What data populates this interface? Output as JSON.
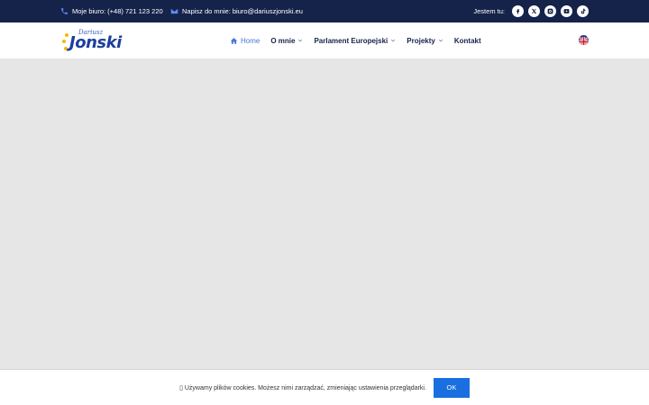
{
  "topbar": {
    "phone_text": "Moje biuro: (+48) 721 123 220",
    "email_text": "Napisz do mnie: biuro@dariuszjonski.eu",
    "social_label": "Jestem tu:",
    "social_icons": [
      "facebook-icon",
      "x-icon",
      "instagram-icon",
      "youtube-icon",
      "tiktok-icon"
    ]
  },
  "logo": {
    "small": "Dariusz",
    "big": "Jonski"
  },
  "nav": {
    "home": "Home",
    "about": "O mnie",
    "parliament": "Parlament Europejski",
    "projects": "Projekty",
    "contact": "Kontakt"
  },
  "cookie": {
    "message": "▯ Używamy plików cookies. Możesz nimi zarządzać, zmieniając ustawienia przeglądarki.",
    "ok_label": "OK"
  },
  "colors": {
    "topbar": "#15234a",
    "accent": "#4a76d8",
    "button": "#1a6fe0"
  }
}
